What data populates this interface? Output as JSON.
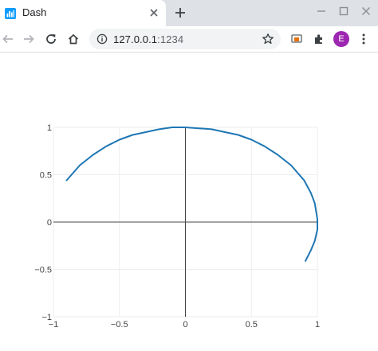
{
  "browser": {
    "tab": {
      "title": "Dash",
      "favicon": "dash-chart-icon"
    },
    "url": {
      "host": "127.0.0.1",
      "port": ":1234"
    },
    "profile_initial": "E",
    "accent": "#9c27b0"
  },
  "chart_data": {
    "type": "line",
    "title": "",
    "xlabel": "",
    "ylabel": "",
    "xlim": [
      -1,
      1
    ],
    "ylim": [
      -1,
      1
    ],
    "grid": true,
    "x_ticks": [
      -1,
      -0.5,
      0,
      0.5,
      1
    ],
    "x_tick_labels": [
      "−1",
      "−0.5",
      "0",
      "0.5",
      "1"
    ],
    "y_ticks": [
      1,
      0.5,
      0,
      -0.5,
      -1
    ],
    "y_tick_labels": [
      "1",
      "0.5",
      "0",
      "−0.5",
      "−1"
    ],
    "series": [
      {
        "color": "#1f77b4",
        "x": [
          -0.9,
          -0.8,
          -0.7,
          -0.6,
          -0.5,
          -0.4,
          -0.3,
          -0.2,
          -0.1,
          0.0,
          0.1,
          0.2,
          0.3,
          0.4,
          0.5,
          0.6,
          0.7,
          0.8,
          0.9,
          0.95,
          0.98,
          1.0,
          1.0,
          0.98,
          0.95,
          0.91
        ],
        "y": [
          0.44,
          0.6,
          0.71,
          0.8,
          0.87,
          0.92,
          0.95,
          0.98,
          1.0,
          1.0,
          0.99,
          0.98,
          0.95,
          0.92,
          0.87,
          0.8,
          0.71,
          0.6,
          0.44,
          0.31,
          0.2,
          0.03,
          -0.08,
          -0.2,
          -0.3,
          -0.41
        ]
      }
    ]
  }
}
